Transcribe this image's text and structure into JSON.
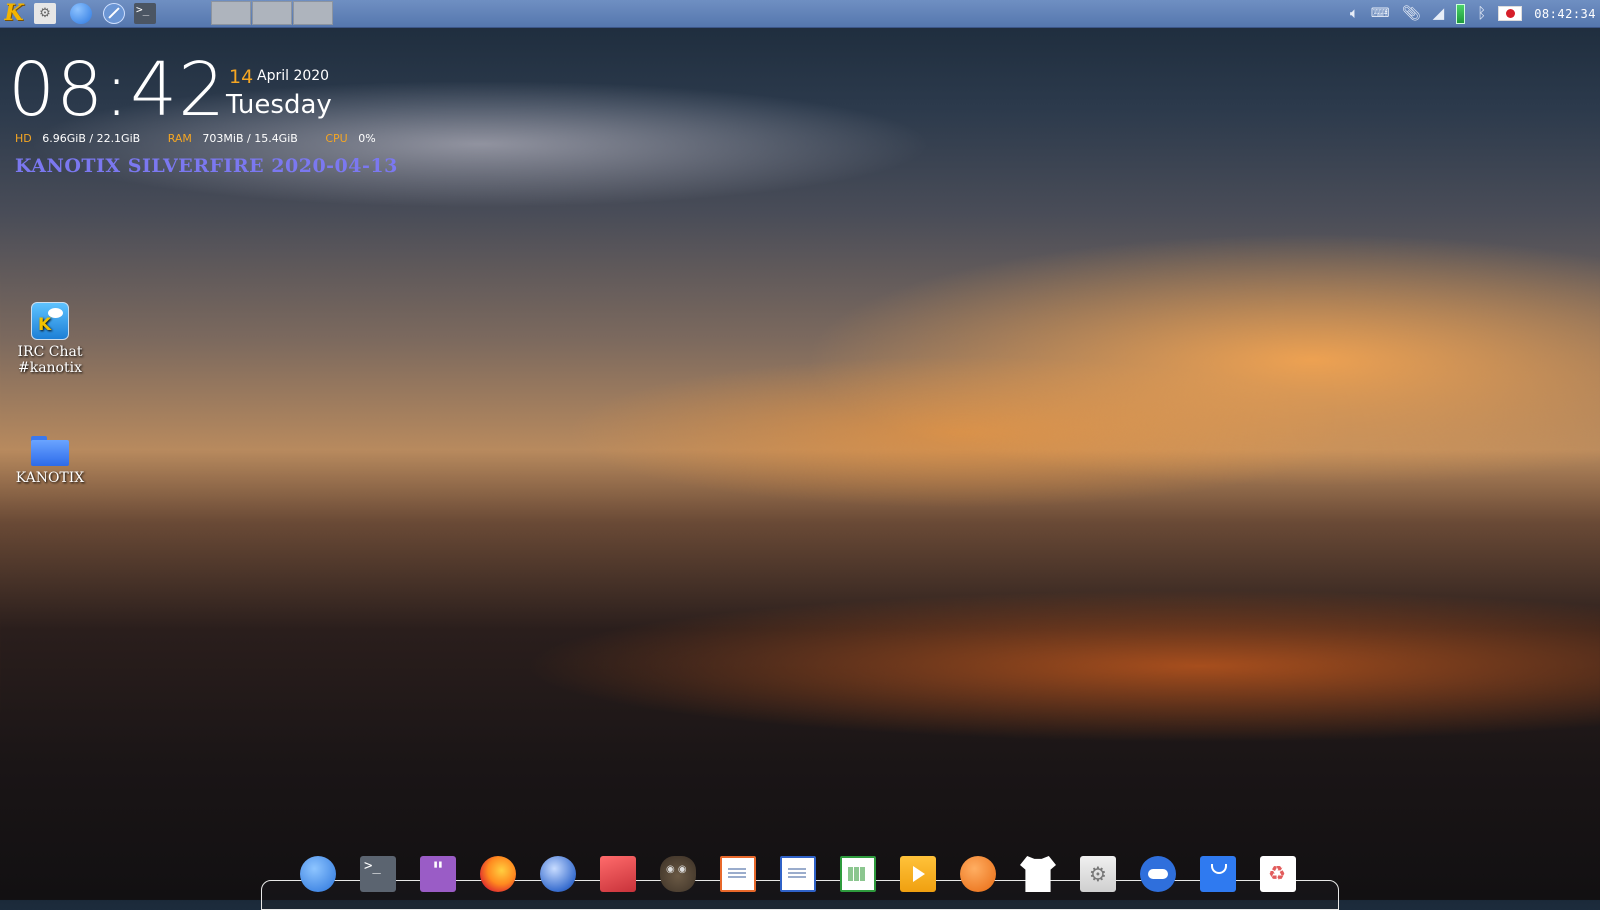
{
  "panel": {
    "quick_launch": [
      {
        "name": "kanotix-menu",
        "icon": "kanotix-k-logo",
        "label": "K"
      },
      {
        "name": "settings",
        "icon": "settings-icon"
      },
      {
        "name": "files",
        "icon": "folder-icon"
      },
      {
        "name": "browser",
        "icon": "compass-icon"
      },
      {
        "name": "terminal",
        "icon": "terminal-icon",
        "label": ">_"
      }
    ],
    "workspaces": 3,
    "tray": {
      "icons": [
        "volume-icon",
        "keyboard-icon",
        "clipboard-icon",
        "wifi-icon",
        "battery-icon",
        "bluetooth-icon",
        "japan-flag-icon"
      ],
      "clock": "08:42:34"
    },
    "accent": "#5e7fb6"
  },
  "conky": {
    "time": "08:42",
    "day": "14",
    "month_year": "April 2020",
    "weekday": "Tuesday",
    "hd_label": "HD",
    "hd_value": "6.96GiB / 22.1GiB",
    "ram_label": "RAM",
    "ram_value": "703MiB / 15.4GiB",
    "cpu_label": "CPU",
    "cpu_value": "0%",
    "label_color": "#f5a623"
  },
  "banner": {
    "text": "KANOTIX SILVERFIRE 2020-04-13",
    "color": "#7b78f0"
  },
  "desktop_icons": [
    {
      "label": "IRC Chat #kanotix",
      "icon": "irc-chat-icon"
    },
    {
      "label": "KANOTIX",
      "icon": "folder-icon"
    }
  ],
  "dock": [
    "files-icon",
    "terminal-icon",
    "notes-icon",
    "firefox-icon",
    "thunderbird-icon",
    "image-viewer-icon",
    "gimp-icon",
    "impress-icon",
    "writer-icon",
    "calc-icon",
    "media-player-icon",
    "vivaldi-icon",
    "theme-icon",
    "settings-icon",
    "toggle-icon",
    "store-icon",
    "trash-icon"
  ]
}
